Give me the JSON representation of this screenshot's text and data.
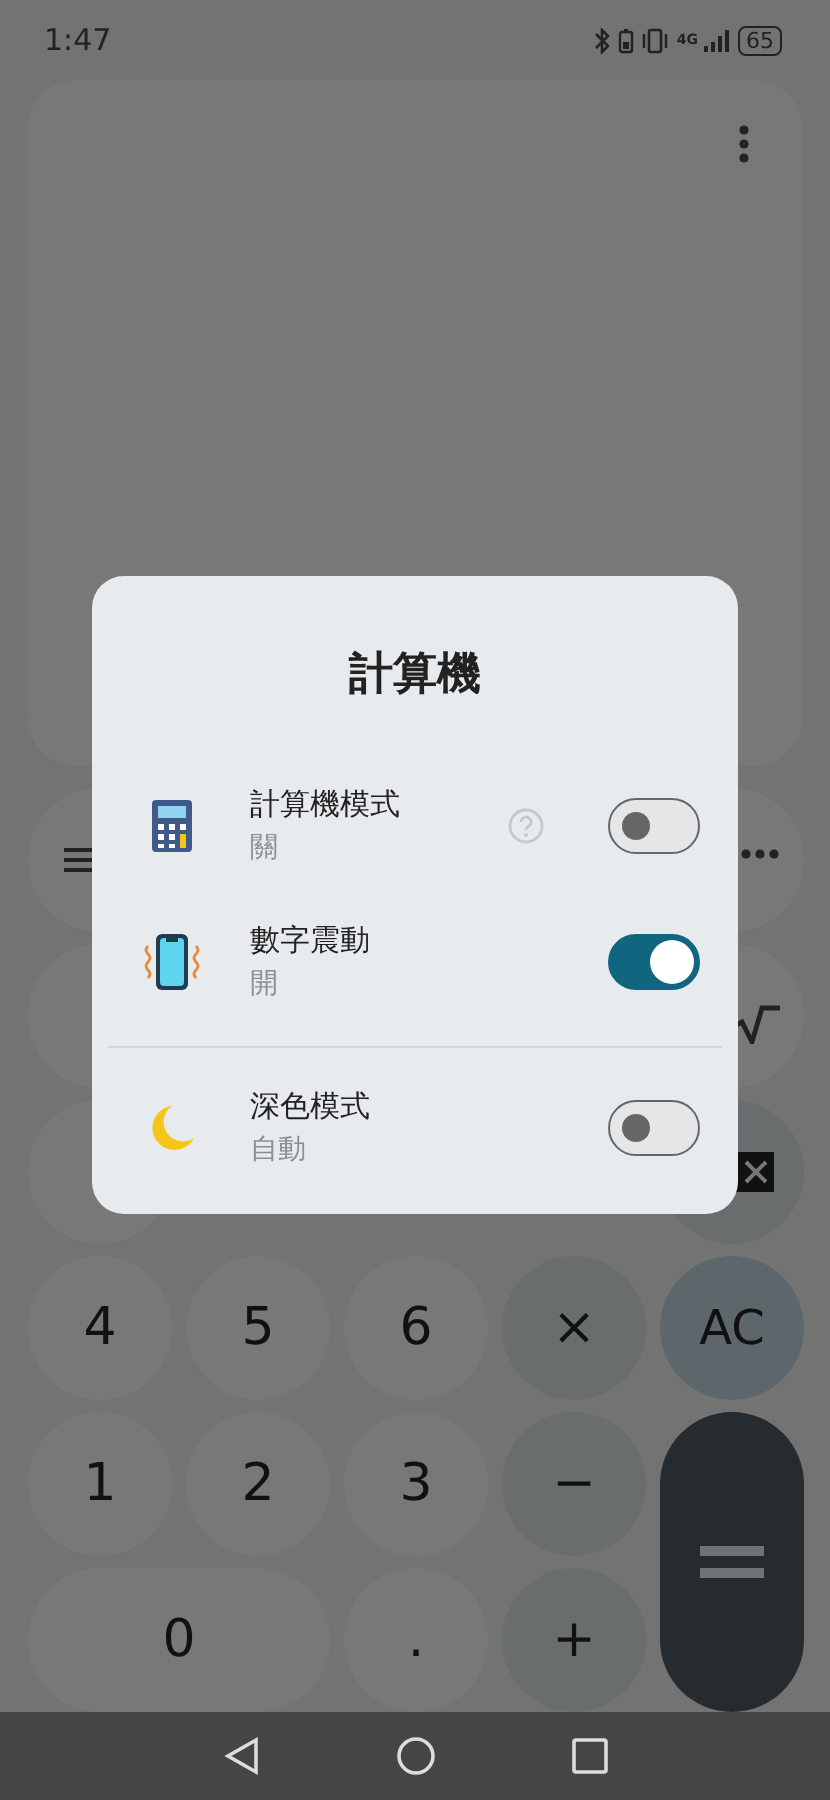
{
  "status_bar": {
    "time": "1:47",
    "network": "4G",
    "battery": "65"
  },
  "dialog": {
    "title": "計算機",
    "groups": [
      [
        {
          "kind": "calculator",
          "label": "計算機模式",
          "value": "關",
          "help": true,
          "on": false
        },
        {
          "kind": "vibration",
          "label": "數字震動",
          "value": "開",
          "help": false,
          "on": true
        }
      ],
      [
        {
          "kind": "theme",
          "label": "深色模式",
          "value": "自動",
          "help": false,
          "on": false
        }
      ]
    ]
  },
  "keypad": [
    {
      "kind": "menu"
    },
    {
      "kind": "more"
    },
    {
      "kind": "blank"
    },
    {
      "kind": "root"
    },
    {
      "kind": "blank"
    },
    {
      "kind": "backspace"
    },
    {
      "kind": "digit",
      "label": "4"
    },
    {
      "kind": "digit",
      "label": "5"
    },
    {
      "kind": "digit",
      "label": "6"
    },
    {
      "kind": "operator",
      "label": "×"
    },
    {
      "kind": "clear",
      "label": "AC"
    },
    {
      "kind": "digit",
      "label": "1"
    },
    {
      "kind": "digit",
      "label": "2"
    },
    {
      "kind": "digit",
      "label": "3"
    },
    {
      "kind": "operator",
      "label": "−"
    },
    {
      "kind": "equals"
    },
    {
      "kind": "zero",
      "label": "0"
    },
    {
      "kind": "digit",
      "label": "."
    },
    {
      "kind": "operator",
      "label": "+"
    }
  ]
}
